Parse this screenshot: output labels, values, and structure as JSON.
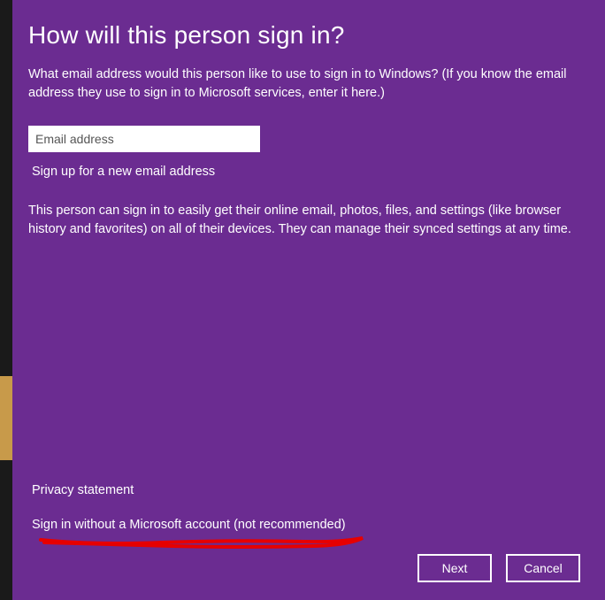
{
  "colors": {
    "dialog_bg": "#6b2c91",
    "text": "#ffffff",
    "annotation": "#e60000"
  },
  "title": "How will this person sign in?",
  "subtitle": "What email address would this person like to use to sign in to Windows? (If you know the email address they use to sign in to Microsoft services, enter it here.)",
  "email": {
    "placeholder": "Email address",
    "value": ""
  },
  "signup_link": "Sign up for a new email address",
  "info_text": "This person can sign in to easily get their online email, photos, files, and settings (like browser history and favorites) on all of their devices. They can manage their synced settings at any time.",
  "privacy_link": "Privacy statement",
  "no_account_link": "Sign in without a Microsoft account (not recommended)",
  "buttons": {
    "next": "Next",
    "cancel": "Cancel"
  }
}
